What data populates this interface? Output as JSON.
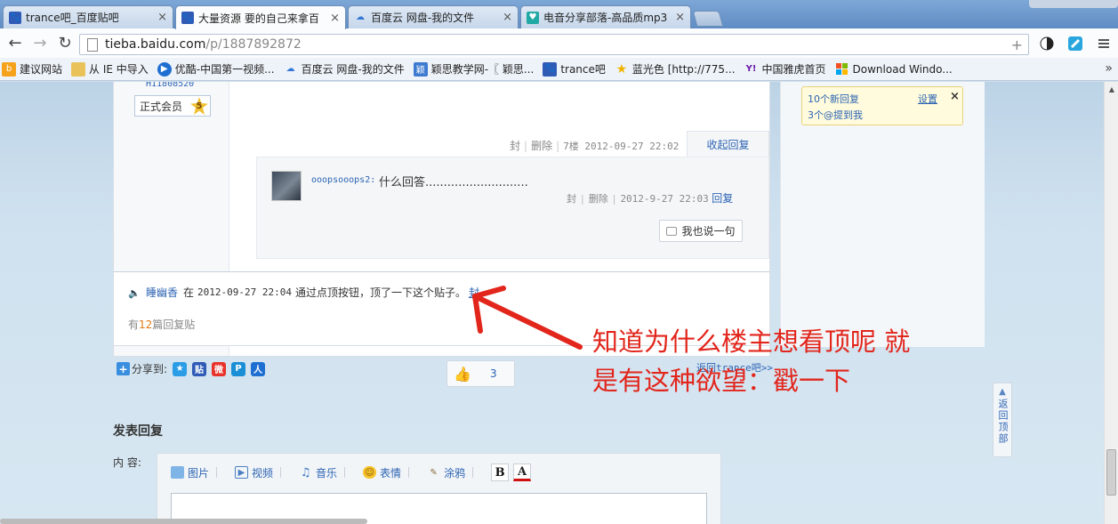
{
  "browser": {
    "tabs": [
      {
        "title": "trance吧_百度贴吧",
        "active": false,
        "icon": "baidu-paw-icon"
      },
      {
        "title": "大量资源 要的自己来拿百",
        "active": true,
        "icon": "baidu-paw-icon"
      },
      {
        "title": "百度云 网盘-我的文件",
        "active": false,
        "icon": "baidu-cloud-icon"
      },
      {
        "title": "电音分享部落-高品质mp3",
        "active": false,
        "icon": "heart-shield-icon"
      }
    ],
    "url_host": "tieba.baidu.com",
    "url_path": "/p/1887892872",
    "bookmarks": [
      {
        "label": "建议网站",
        "icon": "bing-icon"
      },
      {
        "label": "从 IE 中导入",
        "icon": "folder-icon"
      },
      {
        "label": "优酷-中国第一视频...",
        "icon": "youku-icon"
      },
      {
        "label": "百度云 网盘-我的文件",
        "icon": "baidu-cloud-icon"
      },
      {
        "label": "颖思教学网-〖 颖思...",
        "icon": "ying-icon"
      },
      {
        "label": "trance吧",
        "icon": "baidu-paw-icon"
      },
      {
        "label": "蓝光色 [http://775...",
        "icon": "star-icon"
      },
      {
        "label": "中国雅虎首页",
        "icon": "yahoo-icon"
      },
      {
        "label": "Download Windo...",
        "icon": "windows-icon"
      }
    ]
  },
  "post": {
    "author_id": "H11808520",
    "member_badge": "正式会员",
    "member_level": "5",
    "meta_feng": "封",
    "meta_delete": "删除",
    "meta_floor_time": "7楼 2012-09-27 22:02",
    "fold_reply": "收起回复"
  },
  "lzl": {
    "user": "ooopsooops2:",
    "text": "什么回答............................",
    "feng": "封",
    "delete": "删除",
    "time": "2012-9-27 22:03",
    "reply": "回复",
    "say_button": "我也说一句"
  },
  "ding": {
    "user": "睡幽香",
    "at": "在",
    "time": "2012-09-27 22:04",
    "text": "通过点顶按钮，顶了一下这个贴子。",
    "feng": "封",
    "count_prefix": "有",
    "count": "12",
    "count_suffix": "篇回复贴"
  },
  "notify": {
    "line1": "10个新回复",
    "line2": "3个@提到我",
    "settings": "设置",
    "close": "×"
  },
  "share": {
    "label": "分享到:",
    "like_count": "3",
    "back_to_bar": "返回trance吧>>"
  },
  "reply_form": {
    "title": "发表回复",
    "content_label": "内  容:",
    "tools": [
      {
        "label": "图片",
        "icon": "image-icon"
      },
      {
        "label": "视频",
        "icon": "video-icon"
      },
      {
        "label": "音乐",
        "icon": "music-icon"
      },
      {
        "label": "表情",
        "icon": "smiley-icon"
      },
      {
        "label": "涂鸦",
        "icon": "brush-icon"
      }
    ],
    "bold": "B",
    "color": "A"
  },
  "back_top": "返回顶部",
  "annotation": {
    "line1": "知道为什么楼主想看顶呢 就",
    "line2": "是有这种欲望：戳一下",
    "color": "#e2261c"
  }
}
